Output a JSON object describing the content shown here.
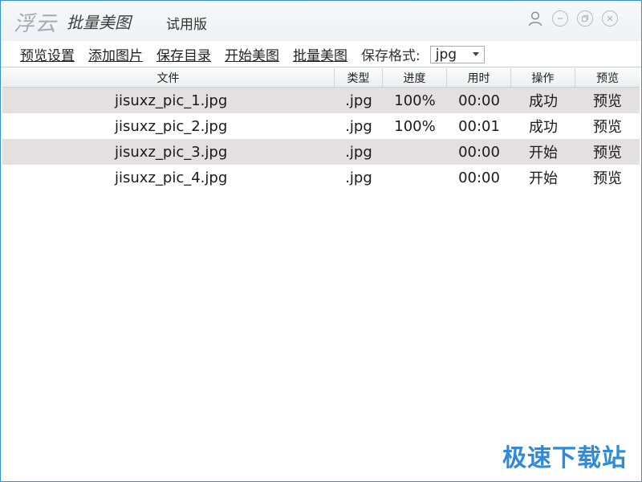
{
  "titlebar": {
    "brand": "浮云",
    "app_name": "批量美图",
    "edition": "试用版"
  },
  "toolbar": {
    "links": [
      "预览设置",
      "添加图片",
      "保存目录",
      "开始美图",
      "批量美图"
    ],
    "format_label": "保存格式:",
    "format_value": "jpg"
  },
  "table": {
    "headers": [
      "文件",
      "类型",
      "进度",
      "用时",
      "操作",
      "预览"
    ],
    "rows": [
      {
        "file": "jisuxz_pic_1.jpg",
        "type": ".jpg",
        "progress": "100%",
        "time": "00:00",
        "action": "成功",
        "preview": "预览"
      },
      {
        "file": "jisuxz_pic_2.jpg",
        "type": ".jpg",
        "progress": "100%",
        "time": "00:01",
        "action": "成功",
        "preview": "预览"
      },
      {
        "file": "jisuxz_pic_3.jpg",
        "type": ".jpg",
        "progress": "",
        "time": "00:00",
        "action": "开始",
        "preview": "预览"
      },
      {
        "file": "jisuxz_pic_4.jpg",
        "type": ".jpg",
        "progress": "",
        "time": "00:00",
        "action": "开始",
        "preview": "预览"
      }
    ]
  },
  "watermark": "极速下载站",
  "icons": [
    "user-icon",
    "minimize-icon",
    "restore-icon",
    "close-icon",
    "dropdown-caret-icon"
  ],
  "colors": {
    "accent": "#2f8ad8",
    "row_alt": "#e4dfe0",
    "border": "#3a8fd6"
  }
}
